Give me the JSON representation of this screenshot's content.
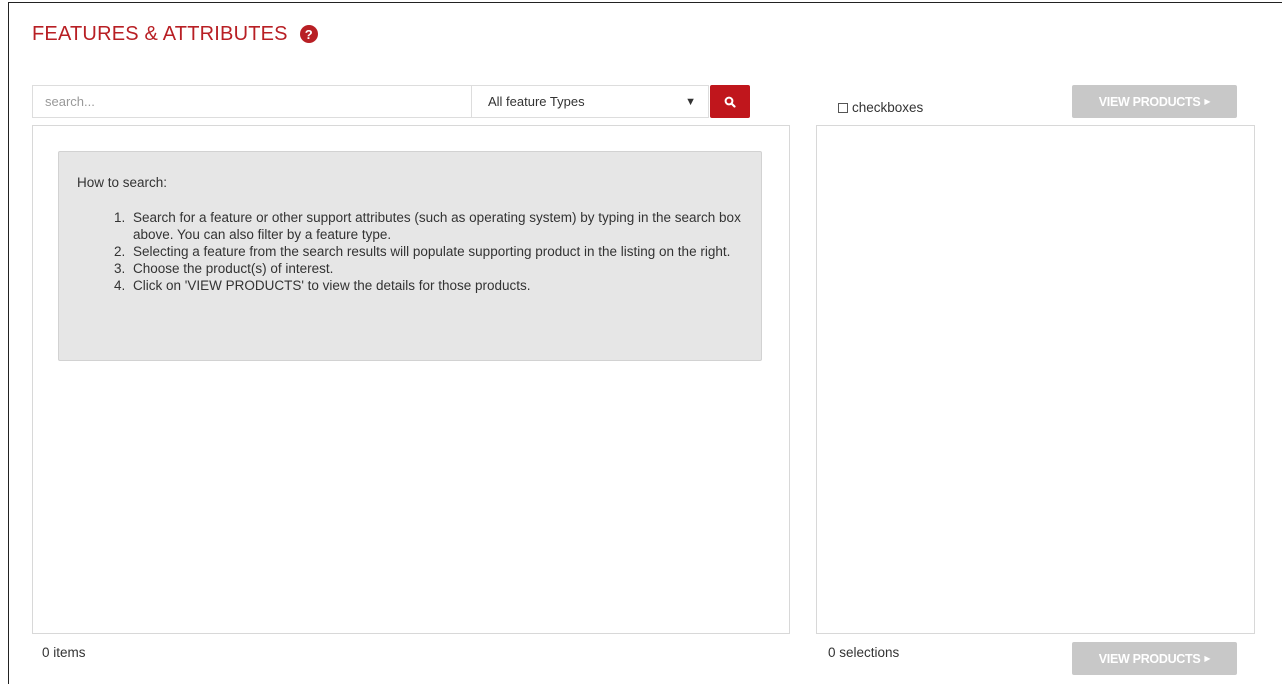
{
  "header": {
    "title": "FEATURES & ATTRIBUTES",
    "help_icon": "question-circle-icon"
  },
  "search": {
    "placeholder": "search...",
    "value": "",
    "type_select": {
      "selected": "All feature Types",
      "caret_glyph": "▼"
    },
    "button_icon": "search-icon"
  },
  "howto": {
    "title": "How to search:",
    "steps": [
      "Search for a feature or other support attributes (such as operating system) by typing in the search box above. You can also filter by a feature type.",
      "Selecting a feature from the search results will populate supporting product in the listing on the right.",
      "Choose the product(s) of interest.",
      "Click on 'VIEW PRODUCTS' to view the details for those products."
    ]
  },
  "right": {
    "checkbox_label": "checkboxes",
    "view_products_label": "VIEW PRODUCTS",
    "view_products_arrow": "▶"
  },
  "footer": {
    "items_count": "0 items",
    "selections_count": "0 selections"
  },
  "colors": {
    "accent": "#b81f24",
    "search_button": "#c0161c",
    "disabled_button": "#c8c8c8",
    "howto_background": "#e6e6e6"
  }
}
